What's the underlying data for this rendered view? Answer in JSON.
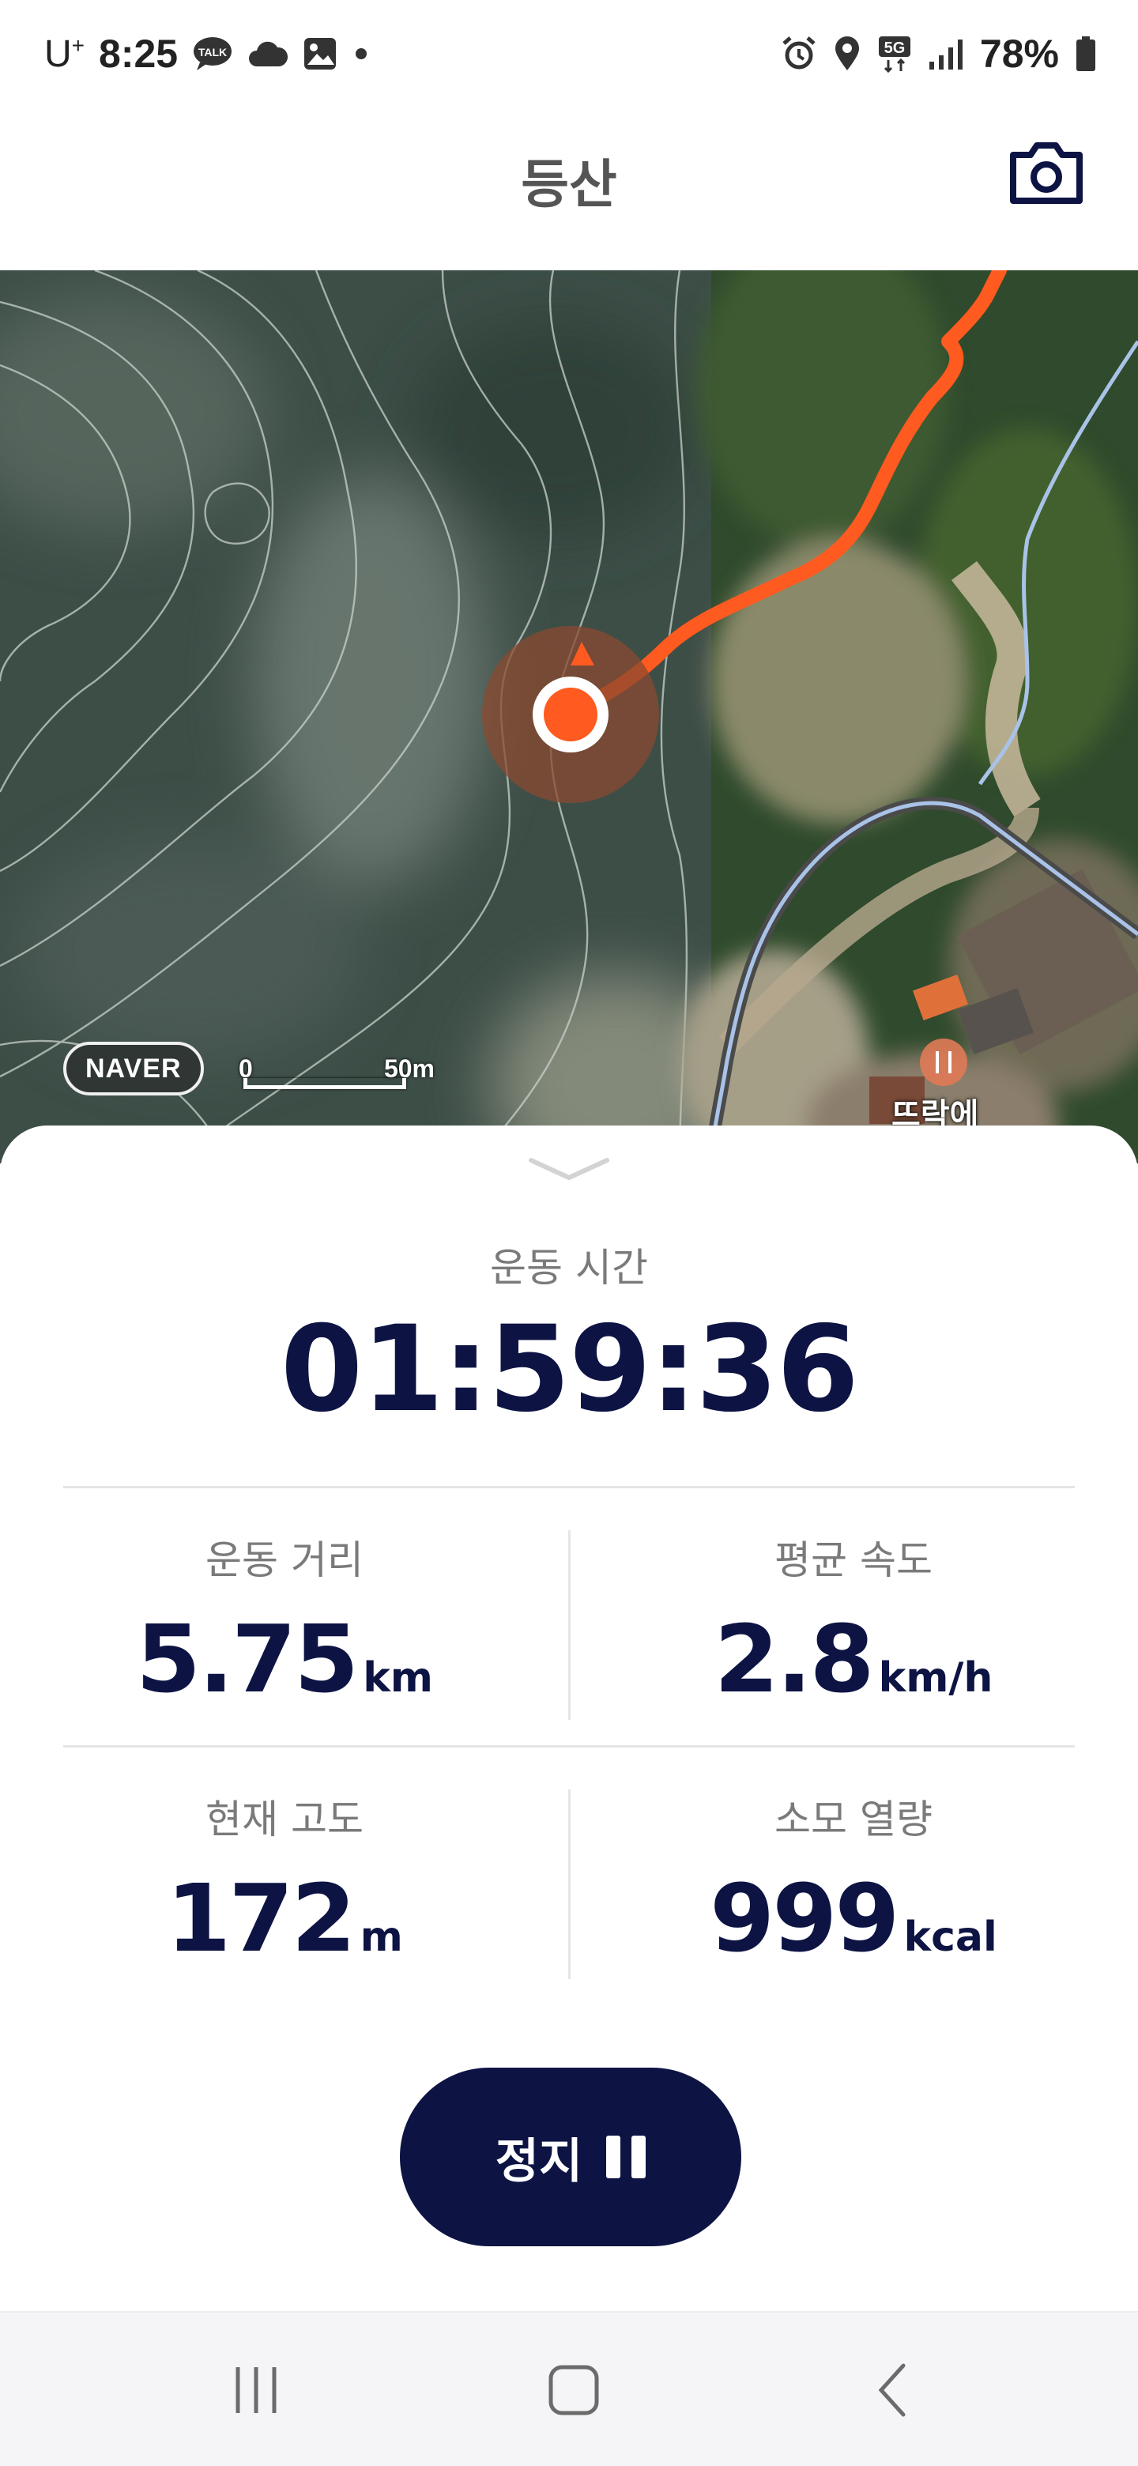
{
  "status_bar": {
    "carrier": "U",
    "carrier_sup": "+",
    "time": "8:25",
    "battery": "78%",
    "icons": [
      "kakaotalk-icon",
      "cloud-icon",
      "gallery-icon",
      "dot-icon",
      "alarm-icon",
      "location-icon",
      "5g-icon",
      "signal-icon",
      "battery-icon"
    ]
  },
  "header": {
    "title": "등산",
    "camera_icon": "camera-icon"
  },
  "map": {
    "provider_badge": "NAVER",
    "scale_zero": "0",
    "scale_max": "50m",
    "poi_label": "뜨락에",
    "route_color": "#ff5a1f",
    "location_color": "#ff5a1f",
    "trail_color": "#a9c3e8"
  },
  "workout": {
    "time_label": "운동 시간",
    "time_value": "01:59:36",
    "stats": [
      {
        "label": "운동 거리",
        "value": "5.75",
        "unit": "km"
      },
      {
        "label": "평균 속도",
        "value": "2.8",
        "unit": "km/h"
      },
      {
        "label": "현재 고도",
        "value": "172",
        "unit": "m"
      },
      {
        "label": "소모 열량",
        "value": "999",
        "unit": "kcal"
      }
    ],
    "pause_label": "정지"
  },
  "colors": {
    "primary": "#0d1444",
    "accent": "#ff5a1f"
  },
  "nav_bar": {
    "icons": [
      "recents-icon",
      "home-icon",
      "back-icon"
    ]
  }
}
